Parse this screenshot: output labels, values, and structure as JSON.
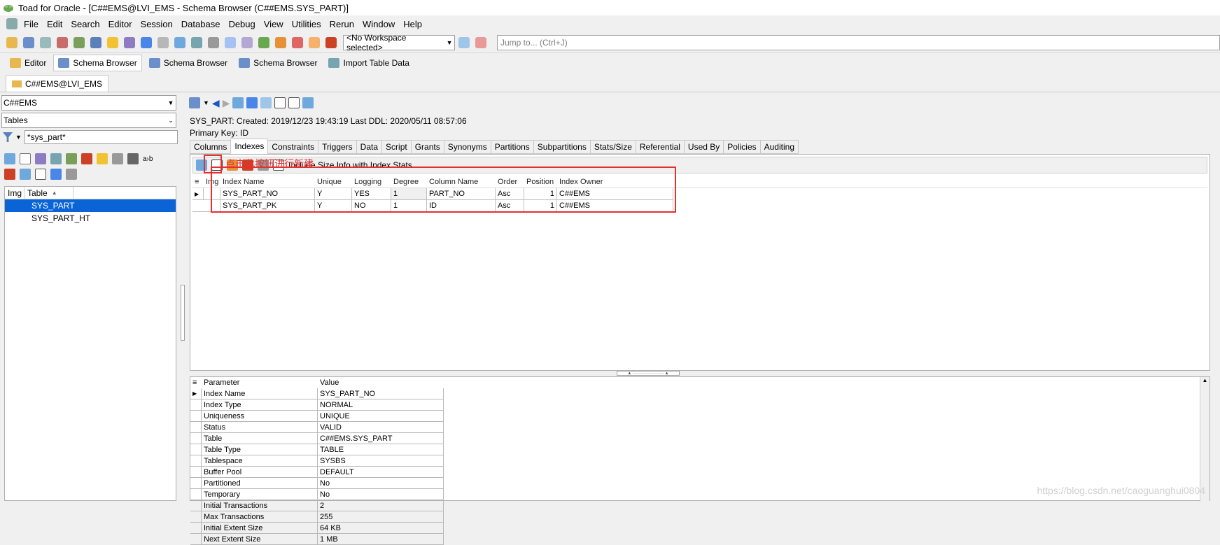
{
  "window": {
    "title": "Toad for Oracle - [C##EMS@LVI_EMS - Schema Browser (C##EMS.SYS_PART)]"
  },
  "menu": [
    "File",
    "Edit",
    "Search",
    "Editor",
    "Session",
    "Database",
    "Debug",
    "View",
    "Utilities",
    "Rerun",
    "Window",
    "Help"
  ],
  "toolbar": {
    "workspace": "<No Workspace selected>",
    "jump_placeholder": "Jump to... (Ctrl+J)"
  },
  "window_tabs": [
    "Editor",
    "Schema Browser",
    "Schema Browser",
    "Schema Browser",
    "Import Table Data"
  ],
  "connection_tab": "C##EMS@LVI_EMS",
  "left": {
    "schema": "C##EMS",
    "object_type": "Tables",
    "filter": "*sys_part*",
    "col_img": "Img",
    "col_table": "Table",
    "tables": [
      "SYS_PART",
      "SYS_PART_HT"
    ],
    "selected": "SYS_PART"
  },
  "right": {
    "info_line": "SYS_PART:  Created: 2019/12/23 19:43:19  Last DDL: 2020/05/11 08:57:06",
    "pk_line": "Primary Key:  ID",
    "tabs": [
      "Columns",
      "Indexes",
      "Constraints",
      "Triggers",
      "Data",
      "Script",
      "Grants",
      "Synonyms",
      "Partitions",
      "Subpartitions",
      "Stats/Size",
      "Referential",
      "Used By",
      "Policies",
      "Auditing"
    ],
    "active_tab": "Indexes",
    "index_toolbar_text": "Include Size Info with Index Stats",
    "overlay_text": "点击此按钮进行新建",
    "index_columns": [
      "Img",
      "Index Name",
      "Unique",
      "Logging",
      "Degree",
      "Column Name",
      "Order",
      "Position",
      "Index Owner"
    ],
    "index_rows": [
      {
        "name": "SYS_PART_NO",
        "unique": "Y",
        "logging": "YES",
        "degree": "1",
        "column": "PART_NO",
        "order": "Asc",
        "position": "1",
        "owner": "C##EMS"
      },
      {
        "name": "SYS_PART_PK",
        "unique": "Y",
        "logging": "NO",
        "degree": "1",
        "column": "ID",
        "order": "Asc",
        "position": "1",
        "owner": "C##EMS"
      }
    ],
    "detail_columns": [
      "Parameter",
      "Value"
    ],
    "detail_rows": [
      [
        "Index Name",
        "SYS_PART_NO"
      ],
      [
        "Index Type",
        "NORMAL"
      ],
      [
        "Uniqueness",
        "UNIQUE"
      ],
      [
        "Status",
        "VALID"
      ],
      [
        "Table",
        "C##EMS.SYS_PART"
      ],
      [
        "Table Type",
        "TABLE"
      ],
      [
        "Tablespace",
        "SYSBS"
      ],
      [
        "Buffer Pool",
        "DEFAULT"
      ],
      [
        "Partitioned",
        "No"
      ],
      [
        "Temporary",
        "No"
      ],
      [
        "Initial Transactions",
        "2"
      ],
      [
        "Max Transactions",
        "255"
      ],
      [
        "Initial Extent Size",
        "64 KB"
      ],
      [
        "Next Extent Size",
        "1 MB"
      ]
    ]
  },
  "watermark": "https://blog.csdn.net/caoguanghui0804",
  "colors": {
    "selection": "#0a64d6",
    "highlight_box": "#e53030"
  }
}
